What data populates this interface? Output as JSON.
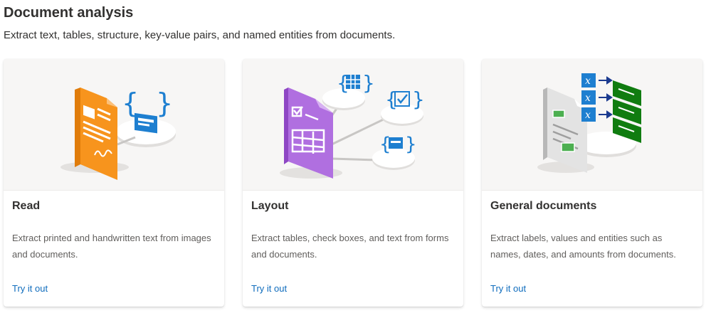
{
  "page": {
    "title": "Document analysis",
    "subtitle": "Extract text, tables, structure, key-value pairs, and named entities from documents."
  },
  "cards": [
    {
      "title": "Read",
      "description": "Extract printed and handwritten text from images and documents.",
      "link": "Try it out",
      "icon": "read-document-icon"
    },
    {
      "title": "Layout",
      "description": "Extract tables, check boxes, and text from forms and documents.",
      "link": "Try it out",
      "icon": "layout-document-icon"
    },
    {
      "title": "General documents",
      "description": "Extract labels, values and entities such as names, dates, and amounts from documents.",
      "link": "Try it out",
      "icon": "general-documents-icon"
    }
  ],
  "colors": {
    "link": "#0f6cbd",
    "read_doc": "#f7941d",
    "layout_doc": "#a55bd6",
    "general_doc": "#d8d8d8",
    "blue_accent": "#1e7fd0",
    "green_accent": "#107c10"
  }
}
